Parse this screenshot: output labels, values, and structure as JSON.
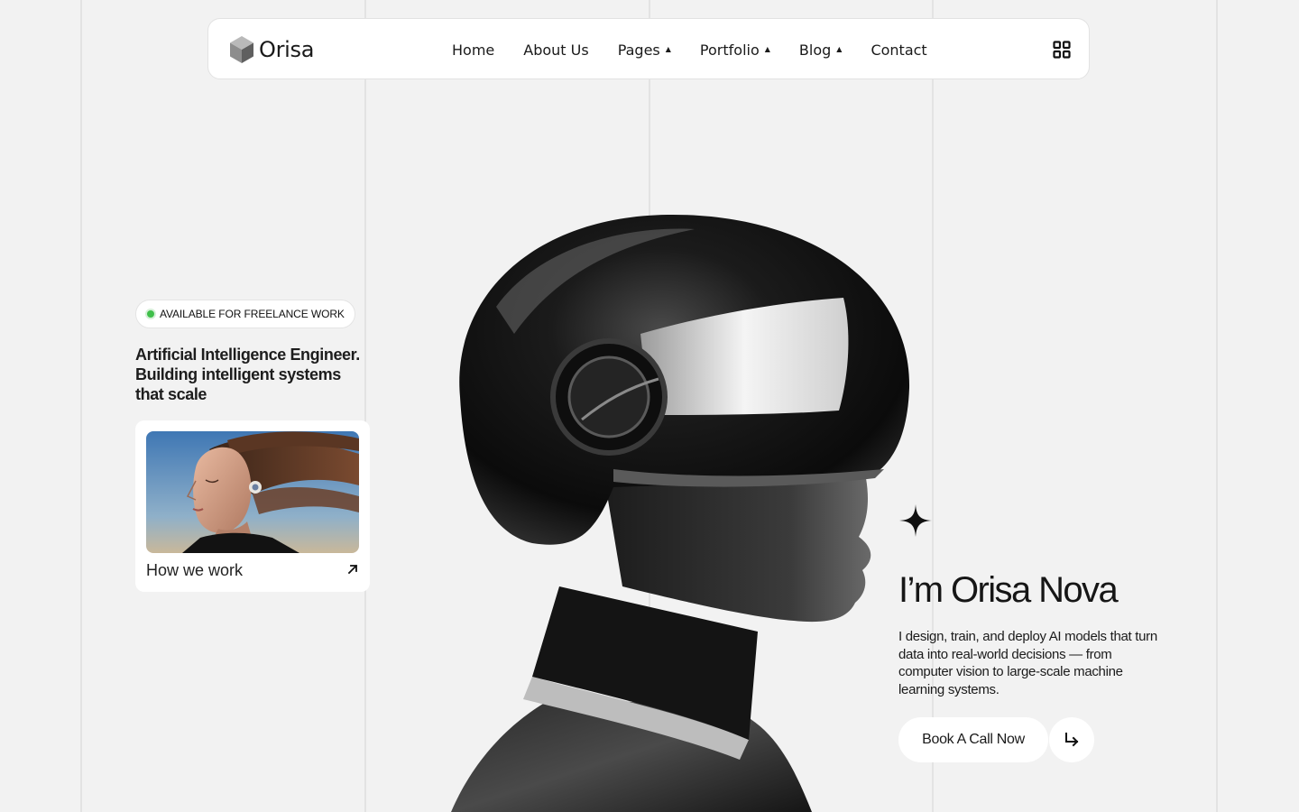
{
  "brand": {
    "name": "Orisa",
    "logo_icon": "cube-icon"
  },
  "nav": {
    "items": [
      {
        "label": "Home",
        "has_dropdown": false
      },
      {
        "label": "About Us",
        "has_dropdown": false
      },
      {
        "label": "Pages",
        "has_dropdown": true
      },
      {
        "label": "Portfolio",
        "has_dropdown": true
      },
      {
        "label": "Blog",
        "has_dropdown": true
      },
      {
        "label": "Contact",
        "has_dropdown": false
      }
    ],
    "dropdown_icon": "caret-up-icon",
    "menu_icon": "grid-icon"
  },
  "intro": {
    "badge": "AVAILABLE FOR FREELANCE WORK",
    "badge_color": "#3fbf4a",
    "tagline": "Artificial Intelligence Engineer. Building intelligent systems that scale"
  },
  "card": {
    "label": "How we work",
    "icon": "arrow-up-right-icon"
  },
  "hero": {
    "title": "I’m Orisa Nova",
    "description": "I design, train, and deploy AI models that turn data into real-world decisions — from computer vision to large-scale machine learning systems.",
    "cta_label": "Book A Call Now",
    "cta_icon": "arrow-turn-right-icon",
    "sparkle_icon": "sparkle-icon"
  },
  "colors": {
    "background": "#f2f2f2",
    "surface": "#ffffff",
    "text": "#111111",
    "guide_lines": "#e3e3e3"
  }
}
